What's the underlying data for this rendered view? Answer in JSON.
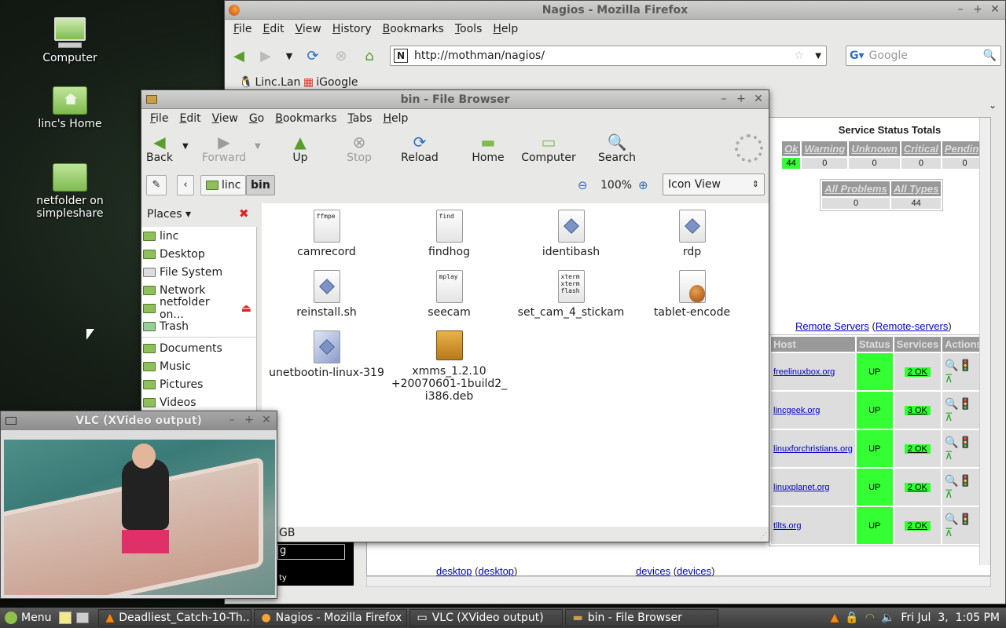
{
  "desktop": {
    "icons": [
      {
        "label": "Computer"
      },
      {
        "label": "linc's Home"
      },
      {
        "label": "netfolder on simpleshare"
      }
    ]
  },
  "firefox": {
    "title": "Nagios - Mozilla Firefox",
    "menu": [
      "File",
      "Edit",
      "View",
      "History",
      "Bookmarks",
      "Tools",
      "Help"
    ],
    "url": "http://mothman/nagios/",
    "search_placeholder": "Google",
    "bookmarks": [
      "Linc.Lan",
      "iGoogle"
    ],
    "service_totals": {
      "title": "Service Status Totals",
      "headers": [
        "Ok",
        "Warning",
        "Unknown",
        "Critical",
        "Pending"
      ],
      "values": [
        "44",
        "0",
        "0",
        "0",
        "0"
      ],
      "summary_headers": [
        "All Problems",
        "All Types"
      ],
      "summary_values": [
        "0",
        "44"
      ]
    },
    "servers": {
      "link": "Remote Servers",
      "link_paren": "Remote-servers",
      "headers": [
        "Host",
        "Status",
        "Services",
        "Actions"
      ],
      "rows": [
        {
          "host": "freelinuxbox.org",
          "status": "UP",
          "services": "2 OK"
        },
        {
          "host": "lincgeek.org",
          "status": "UP",
          "services": "3 OK"
        },
        {
          "host": "linuxforchristians.org",
          "status": "UP",
          "services": "2 OK"
        },
        {
          "host": "linuxplanet.org",
          "status": "UP",
          "services": "2 OK"
        },
        {
          "host": "tllts.org",
          "status": "UP",
          "services": "2 OK"
        }
      ]
    },
    "bottom_links": [
      {
        "name": "desktop",
        "paren": "desktop"
      },
      {
        "name": "devices",
        "paren": "devices"
      }
    ],
    "partial": {
      "gb": "GB",
      "g": "g",
      "ty": "ty"
    }
  },
  "filebrowser": {
    "title": "bin - File Browser",
    "menu": [
      "File",
      "Edit",
      "View",
      "Go",
      "Bookmarks",
      "Tabs",
      "Help"
    ],
    "toolbar": {
      "back": "Back",
      "forward": "Forward",
      "up": "Up",
      "stop": "Stop",
      "reload": "Reload",
      "home": "Home",
      "computer": "Computer",
      "search": "Search"
    },
    "path": [
      "linc",
      "bin"
    ],
    "zoom": "100%",
    "view_mode": "Icon View",
    "places_label": "Places",
    "places": [
      "linc",
      "Desktop",
      "File System",
      "Network",
      "netfolder on...",
      "Trash"
    ],
    "bookmarks": [
      "Documents",
      "Music",
      "Pictures",
      "Videos"
    ],
    "files": [
      {
        "name": "camrecord",
        "tag": "ffmpe"
      },
      {
        "name": "findhog",
        "tag": "find"
      },
      {
        "name": "identibash",
        "tag": ""
      },
      {
        "name": "rdp",
        "tag": ""
      },
      {
        "name": "reinstall.sh",
        "tag": ""
      },
      {
        "name": "seecam",
        "tag": "mplay"
      },
      {
        "name": "set_cam_4_stickam",
        "tag": "xterm\nxterm\nflash"
      },
      {
        "name": "tablet-encode",
        "tag": ""
      },
      {
        "name": "unetbootin-linux-319",
        "tag": ""
      },
      {
        "name": "xmms_1.2.10\n+20070601-1build2_\ni386.deb",
        "tag": ""
      }
    ]
  },
  "vlc": {
    "title": "VLC (XVideo output)"
  },
  "taskbar": {
    "menu": "Menu",
    "tasks": [
      "Deadliest_Catch-10-Th...",
      "Nagios - Mozilla Firefox",
      "VLC (XVideo output)",
      "bin - File Browser"
    ],
    "clock": "Fri Jul  3,  1:05 PM"
  }
}
